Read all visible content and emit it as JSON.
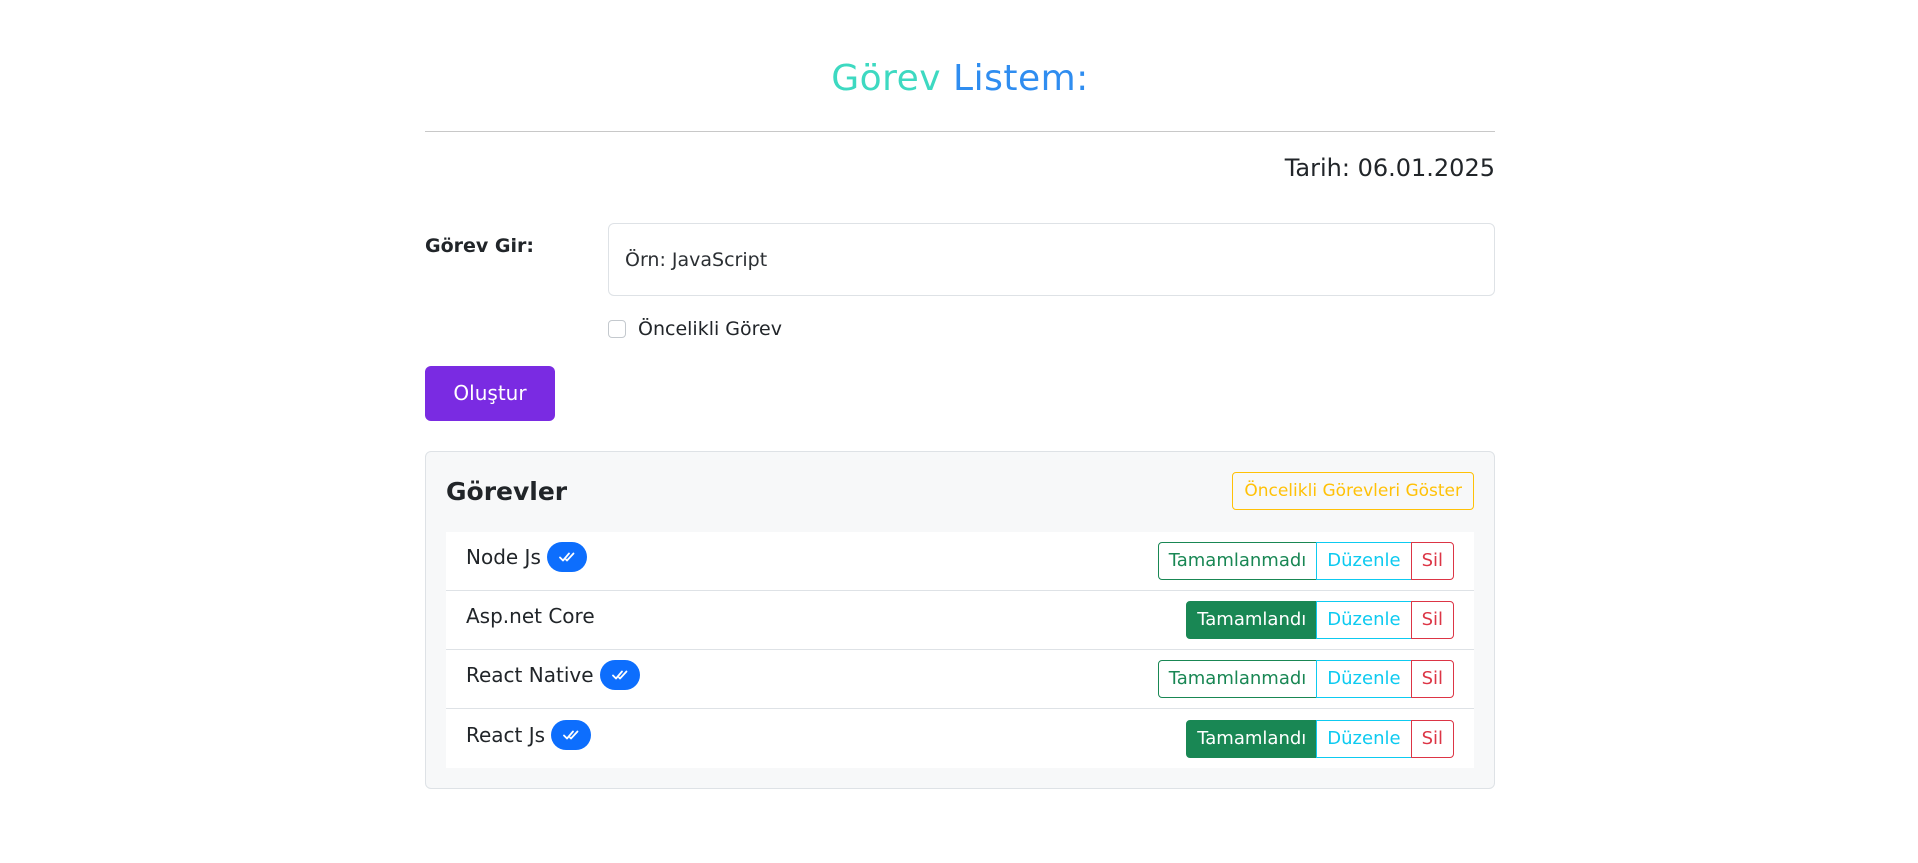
{
  "header": {
    "title_part1": "Görev",
    "title_part2": "Listem:",
    "date_label": "Tarih: 06.01.2025"
  },
  "form": {
    "task_label": "Görev Gir:",
    "task_placeholder": "Örn: JavaScript",
    "task_value": "",
    "priority_checkbox_label": "Öncelikli Görev",
    "priority_checked": false,
    "create_button_label": "Oluştur"
  },
  "tasks_panel": {
    "title": "Görevler",
    "show_priority_button_label": "Öncelikli Görevleri Göster",
    "items": [
      {
        "name": "Node Js",
        "priority": true,
        "status_label": "Tamamlanmadı",
        "completed": false,
        "edit_label": "Düzenle",
        "delete_label": "Sil"
      },
      {
        "name": "Asp.net Core",
        "priority": false,
        "status_label": "Tamamlandı",
        "completed": true,
        "edit_label": "Düzenle",
        "delete_label": "Sil"
      },
      {
        "name": "React Native",
        "priority": true,
        "status_label": "Tamamlanmadı",
        "completed": false,
        "edit_label": "Düzenle",
        "delete_label": "Sil"
      },
      {
        "name": "React Js",
        "priority": true,
        "status_label": "Tamamlandı",
        "completed": true,
        "edit_label": "Düzenle",
        "delete_label": "Sil"
      }
    ]
  },
  "colors": {
    "title_part1": "#3dd9c1",
    "title_part2": "#2f8df0",
    "create_button": "#7a2be2",
    "priority_badge": "#0d6efd",
    "success": "#198754",
    "info": "#0dcaf0",
    "danger": "#dc3545",
    "warning": "#ffc107"
  },
  "icons": {
    "priority_badge_icon": "double-check-icon"
  }
}
